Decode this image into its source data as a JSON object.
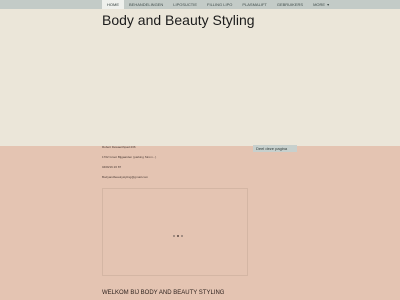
{
  "nav": {
    "items": [
      {
        "label": "HOME",
        "active": true
      },
      {
        "label": "BEHANDELINGEN",
        "active": false
      },
      {
        "label": "LIPOSUCTIE",
        "active": false
      },
      {
        "label": "FILLING LIPO",
        "active": false
      },
      {
        "label": "PLASMALIFT",
        "active": false
      },
      {
        "label": "GEBRUIKERS",
        "active": false
      },
      {
        "label": "More",
        "active": false
      }
    ],
    "more_icon": "chevron-down-icon"
  },
  "site": {
    "title": "Body and Beauty Styling"
  },
  "info": {
    "line1": "Robert Dewaerthpad 236",
    "line2": "1702 Groot Bijgaarden (parking Strom...)",
    "line3": "0469/16 26 87",
    "line4": "Bodyandbeautystyling@gmail.com"
  },
  "share": {
    "label": "Deel deze pagina"
  },
  "slider": {
    "dots": 3,
    "active_index": 1
  },
  "welcome": {
    "text": "WELKOM BIJ BODY AND BEAUTY STYLING"
  },
  "colors": {
    "nav_bg": "#c3cbc7",
    "top_bg": "#ebe6d9",
    "lower_bg": "#e4c4b2"
  }
}
